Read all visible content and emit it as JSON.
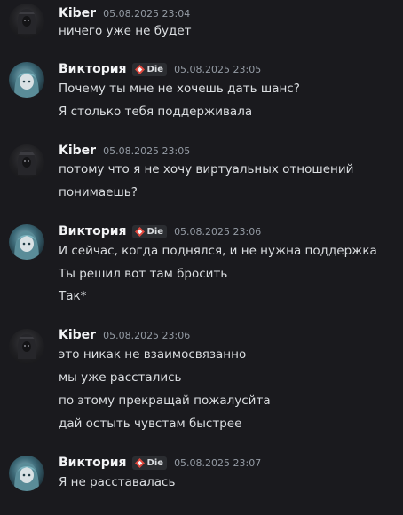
{
  "messages": [
    {
      "author": "Kiber",
      "tag": "",
      "timestamp": "05.08.2025 23:04",
      "lines": [
        "ничего уже не будет"
      ]
    },
    {
      "author": "Виктория",
      "tag": "Die",
      "timestamp": "05.08.2025 23:05",
      "lines": [
        "Почему ты мне не хочешь дать шанс?",
        "Я столько тебя поддерживала"
      ]
    },
    {
      "author": "Kiber",
      "tag": "",
      "timestamp": "05.08.2025 23:05",
      "lines": [
        "потому что я не хочу виртуальных отношений",
        "понимаешь?"
      ]
    },
    {
      "author": "Виктория",
      "tag": "Die",
      "timestamp": "05.08.2025 23:06",
      "lines": [
        "И сейчас, когда поднялся, и не нужна поддержка",
        "Ты решил вот там бросить",
        "Так*"
      ]
    },
    {
      "author": "Kiber",
      "tag": "",
      "timestamp": "05.08.2025 23:06",
      "lines": [
        "это никак не взаимосвязанно",
        "мы уже расстались",
        "по этому прекращай пожалусйта",
        "дай остыть чувстам быстрее"
      ]
    },
    {
      "author": "Виктория",
      "tag": "Die",
      "timestamp": "05.08.2025 23:07",
      "lines": [
        "Я не расставалась"
      ]
    }
  ],
  "colors": {
    "background": "#1a1a1e",
    "text": "#dbdee1",
    "username": "#f2f3f5",
    "timestamp": "#949ba4",
    "tag_icon": "#e0483e"
  },
  "icons": {
    "kiber_avatar": "hooded-figure-avatar",
    "viktoria_avatar": "anime-girl-avatar",
    "tag_icon": "clan-badge-icon"
  }
}
